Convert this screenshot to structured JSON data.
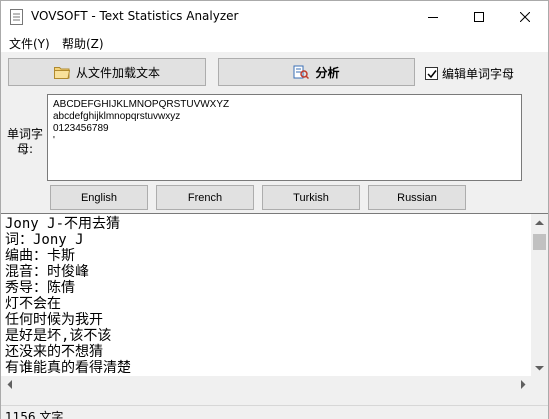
{
  "window": {
    "title": "VOVSOFT - Text Statistics Analyzer"
  },
  "menu": {
    "file": "文件(Y)",
    "help": "帮助(Z)"
  },
  "toolbar": {
    "load_label": "从文件加载文本",
    "analyze_label": "分析",
    "edit_letters_label": "编辑单词字母",
    "edit_letters_checked": true
  },
  "letters": {
    "label_line1": "单词字",
    "label_line2": "母:",
    "lines": [
      "ABCDEFGHIJKLMNOPQRSTUVWXYZ",
      "abcdefghijklmnopqrstuvwxyz",
      "0123456789",
      "'"
    ]
  },
  "languages": [
    "English",
    "French",
    "Turkish",
    "Russian"
  ],
  "main_text": {
    "lines": [
      "Jony J-不用去猜",
      "词：Jony J",
      "编曲：卡斯",
      "混音：时俊峰",
      "秀导：陈倩",
      "灯不会在",
      "任何时候为我开",
      "是好是坏,该不该",
      "还没来的不想猜",
      "有谁能真的看得清楚"
    ]
  },
  "status": {
    "text": "1156 文字"
  },
  "icons": {
    "app": "notepad-icon",
    "load": "folder-icon",
    "analyze": "analyze-icon"
  }
}
